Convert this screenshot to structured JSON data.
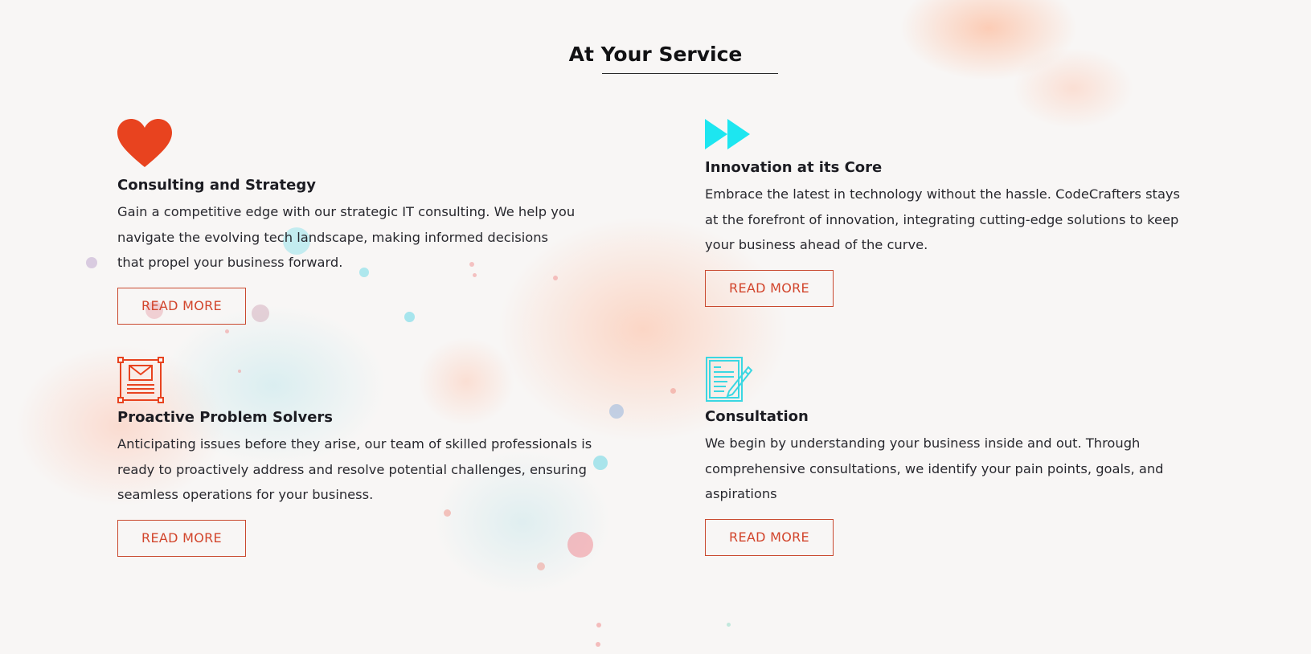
{
  "section": {
    "title": "At Your Service"
  },
  "cards": [
    {
      "icon": "heart-icon",
      "title": "Consulting and Strategy",
      "text": "Gain a competitive edge with our strategic IT consulting. We help you navigate the evolving tech landscape, making informed decisions that propel your business forward.",
      "button": "READ MORE"
    },
    {
      "icon": "fast-forward-icon",
      "title": "Innovation at its Core",
      "text": "Embrace the latest in technology without the hassle. CodeCrafters stays at the forefront of innovation, integrating cutting-edge solutions to keep your business ahead of the curve.",
      "button": "READ MORE"
    },
    {
      "icon": "envelope-newsletter-icon",
      "title": "Proactive Problem Solvers",
      "text": "Anticipating issues before they arise, our team of skilled professionals is ready to proactively address and resolve potential challenges, ensuring seamless operations for your business.",
      "button": "READ MORE"
    },
    {
      "icon": "document-pencil-icon",
      "title": "Consultation",
      "text": "We begin by understanding your business inside and out. Through comprehensive consultations, we identify your pain points, goals, and aspirations",
      "button": "READ MORE"
    }
  ],
  "colors": {
    "accent_orange": "#e8431f",
    "accent_cyan": "#1de6f0",
    "button_border": "#c9492f",
    "background": "#f8f6f5"
  }
}
